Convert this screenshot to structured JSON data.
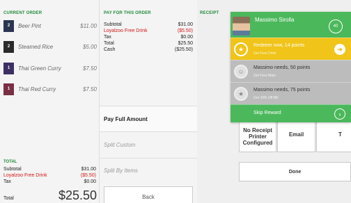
{
  "current_order": {
    "heading": "CURRENT ORDER",
    "items": [
      {
        "qty": "2",
        "name": "Beer Pint",
        "price": "$11.00",
        "color": "#2a3550"
      },
      {
        "qty": "2",
        "name": "Steamed Rice",
        "price": "$5.00",
        "color": "#2a2a2a"
      },
      {
        "qty": "1",
        "name": "Thai Green Curry",
        "price": "$7.50",
        "color": "#3d2f63"
      },
      {
        "qty": "1",
        "name": "Thai Red Curry",
        "price": "$7.50",
        "color": "#7a2f45"
      }
    ],
    "totals": {
      "heading": "TOTAL",
      "subtotal_label": "Subtotal",
      "subtotal": "$31.00",
      "discount_label": "Loyalzoo Free Drink",
      "discount": "($5.50)",
      "tax_label": "Tax",
      "tax": "$0.00",
      "total_label": "Total",
      "total": "$25.50"
    }
  },
  "pay": {
    "heading": "PAY FOR THIS ORDER",
    "subtotal_label": "Subtotal",
    "subtotal": "$31.00",
    "discount_label": "Loyalzoo Free Drink",
    "discount": "($5.50)",
    "tax_label": "Tax",
    "tax": "$0.00",
    "total_label": "Total",
    "total": "$25.50",
    "cash_label": "Cash",
    "cash": "($25.50)",
    "pay_full": "Pay Full Amount",
    "split_custom": "Split Custom",
    "split_items": "Split By Items",
    "back": "Back"
  },
  "receipt": {
    "heading": "RECEIPT",
    "no_printer": "No Receipt Printer Configured",
    "email": "Email",
    "third_partial": "T",
    "done": "Done"
  },
  "loyalty": {
    "customer_name": "Massimo Sirolla",
    "points": "40",
    "rewards": [
      {
        "title": "Redeem now, 14 points",
        "subtitle": "Get Free Drink",
        "icon": "reward-icon",
        "state": "available"
      },
      {
        "title": "Massimo needs, 50 points",
        "subtitle": "Get Free Main",
        "icon": "face-icon",
        "state": "locked"
      },
      {
        "title": "Massimo needs, 75 points",
        "subtitle": "Get 10% Off Bill",
        "icon": "star-icon",
        "state": "locked"
      }
    ],
    "skip": "Skip Reward",
    "colors": {
      "green": "#4cb85c",
      "yellow": "#f0c419",
      "grey": "#bcbcbc"
    }
  }
}
